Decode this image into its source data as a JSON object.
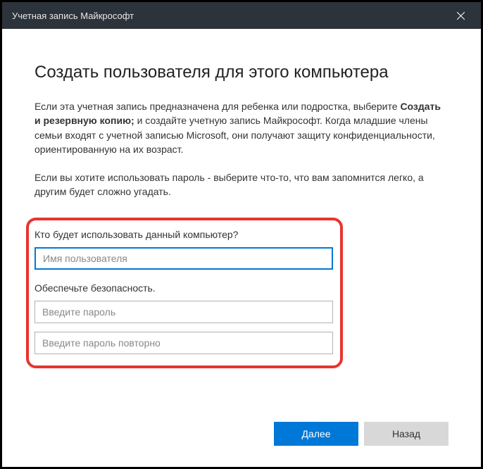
{
  "titlebar": {
    "title": "Учетная запись Майкрософт"
  },
  "heading": "Создать пользователя для этого компьютера",
  "paragraph1": {
    "prefix": "Если эта учетная запись предназначена для ребенка или подростка, выберите ",
    "bold": "Создать и резервную копию;",
    "suffix": " и создайте учетную запись Майкрософт. Когда младшие члены семьи входят с учетной записью Microsoft, они получают защиту конфиденциальности, ориентированную на их возраст."
  },
  "paragraph2": "Если вы хотите использовать пароль - выберите что-то, что вам запомнится легко, а другим будет сложно угадать.",
  "form": {
    "question1": "Кто будет использовать данный компьютер?",
    "username_placeholder": "Имя пользователя",
    "username_value": "",
    "question2": "Обеспечьте безопасность.",
    "password_placeholder": "Введите пароль",
    "password_value": "",
    "password2_placeholder": "Введите пароль повторно",
    "password2_value": ""
  },
  "buttons": {
    "next": "Далее",
    "back": "Назад"
  }
}
